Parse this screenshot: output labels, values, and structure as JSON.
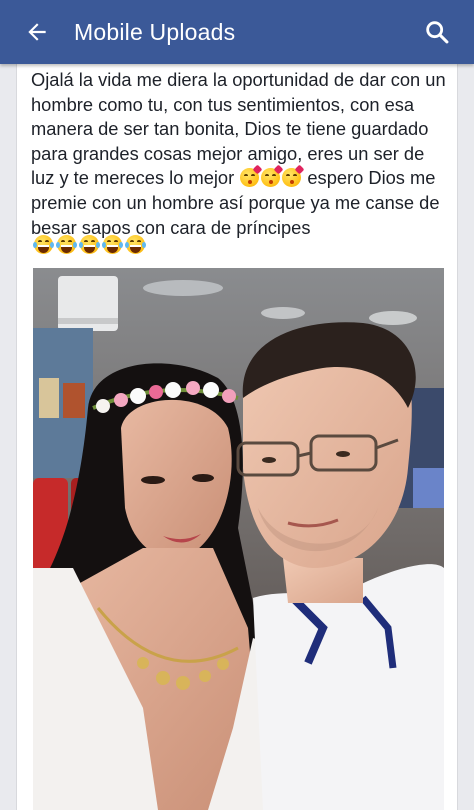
{
  "appbar": {
    "title": "Mobile Uploads",
    "back_icon": "arrow-back-icon",
    "search_icon": "search-icon",
    "color": "#3b5998"
  },
  "post": {
    "text_part1": "Ojalá la vida me diera la oportunidad de dar con un hombre como tu, con tus sentimientos, con esa manera de ser tan bonita, Dios te tiene guardado para grandes cosas mejor amigo, eres un ser de luz y te mereces lo mejor",
    "text_part2": "espero Dios me premie con un hombre así porque ya me canse de besar sapos con cara de príncipes",
    "inline_emojis": [
      "kissing-heart-emoji",
      "kissing-heart-emoji",
      "kissing-heart-emoji"
    ],
    "trailing_emojis": [
      "laughing-tears-emoji",
      "laughing-tears-emoji",
      "laughing-tears-emoji",
      "laughing-tears-emoji",
      "laughing-tears-emoji"
    ]
  },
  "photo": {
    "subject": "selfie-photo"
  }
}
